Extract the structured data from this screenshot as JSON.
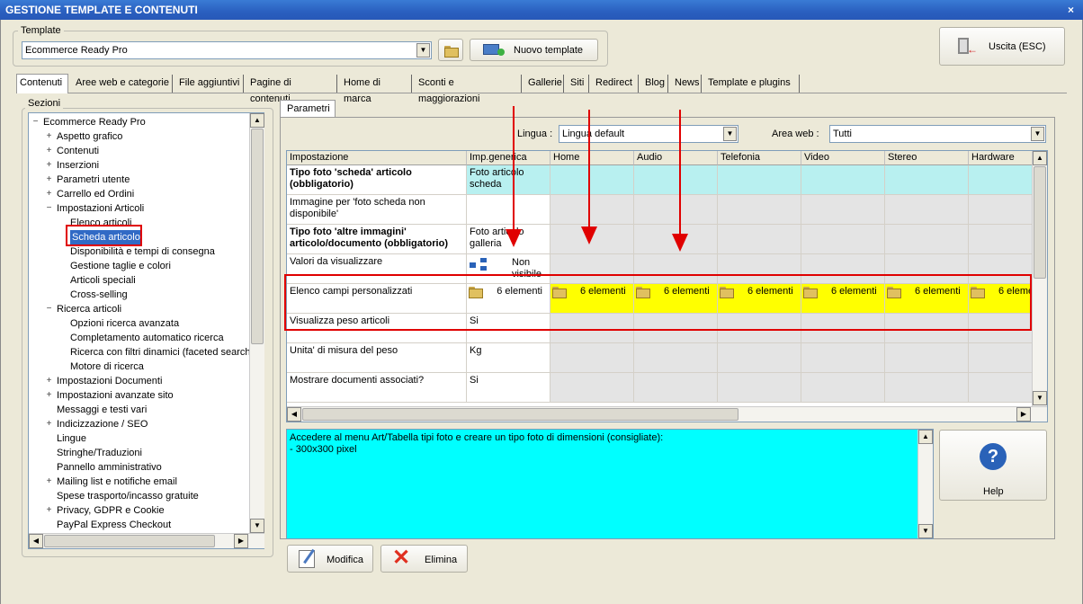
{
  "window": {
    "title": "GESTIONE TEMPLATE E CONTENUTI",
    "close": "×"
  },
  "template_group": {
    "label": "Template",
    "selected": "Ecommerce Ready Pro",
    "new_button": "Nuovo template"
  },
  "exit_button": "Uscita (ESC)",
  "tabs": [
    "Contenuti",
    "Aree web e categorie",
    "File aggiuntivi",
    "Pagine di contenuti",
    "Home di marca",
    "Sconti e maggiorazioni",
    "Gallerie",
    "Siti",
    "Redirect",
    "Blog",
    "News",
    "Template e plugins"
  ],
  "sections": {
    "label": "Sezioni",
    "tree": [
      {
        "label": "Ecommerce Ready Pro",
        "level": 0,
        "exp": "−"
      },
      {
        "label": "Aspetto grafico",
        "level": 1,
        "exp": "+"
      },
      {
        "label": "Contenuti",
        "level": 1,
        "exp": "+"
      },
      {
        "label": "Inserzioni",
        "level": 1,
        "exp": "+"
      },
      {
        "label": "Parametri utente",
        "level": 1,
        "exp": "+"
      },
      {
        "label": "Carrello ed Ordini",
        "level": 1,
        "exp": "+"
      },
      {
        "label": "Impostazioni Articoli",
        "level": 1,
        "exp": "−"
      },
      {
        "label": "Elenco articoli",
        "level": 2,
        "exp": ""
      },
      {
        "label": "Scheda articolo",
        "level": 2,
        "exp": "",
        "selected": true
      },
      {
        "label": "Disponibilità e tempi di consegna",
        "level": 2,
        "exp": ""
      },
      {
        "label": "Gestione taglie e colori",
        "level": 2,
        "exp": ""
      },
      {
        "label": "Articoli speciali",
        "level": 2,
        "exp": ""
      },
      {
        "label": "Cross-selling",
        "level": 2,
        "exp": ""
      },
      {
        "label": "Ricerca articoli",
        "level": 1,
        "exp": "−"
      },
      {
        "label": "Opzioni ricerca avanzata",
        "level": 2,
        "exp": ""
      },
      {
        "label": "Completamento automatico ricerca",
        "level": 2,
        "exp": ""
      },
      {
        "label": "Ricerca con filtri dinamici (faceted search)",
        "level": 2,
        "exp": ""
      },
      {
        "label": "Motore di ricerca",
        "level": 2,
        "exp": ""
      },
      {
        "label": "Impostazioni Documenti",
        "level": 1,
        "exp": "+"
      },
      {
        "label": "Impostazioni avanzate sito",
        "level": 1,
        "exp": "+"
      },
      {
        "label": "Messaggi e testi vari",
        "level": 1,
        "exp": ""
      },
      {
        "label": "Indicizzazione / SEO",
        "level": 1,
        "exp": "+"
      },
      {
        "label": "Lingue",
        "level": 1,
        "exp": ""
      },
      {
        "label": "Stringhe/Traduzioni",
        "level": 1,
        "exp": ""
      },
      {
        "label": "Pannello amministrativo",
        "level": 1,
        "exp": ""
      },
      {
        "label": "Mailing list e notifiche email",
        "level": 1,
        "exp": "+"
      },
      {
        "label": "Spese trasporto/incasso gratuite",
        "level": 1,
        "exp": ""
      },
      {
        "label": "Privacy, GDPR e Cookie",
        "level": 1,
        "exp": "+"
      },
      {
        "label": "PayPal Express Checkout",
        "level": 1,
        "exp": ""
      }
    ]
  },
  "params": {
    "tab": "Parametri",
    "lingua_label": "Lingua :",
    "lingua_value": "Lingua default",
    "area_label": "Area web :",
    "area_value": "Tutti",
    "columns": [
      "Impostazione",
      "Imp.generica",
      "Home",
      "Audio",
      "Telefonia",
      "Video",
      "Stereo",
      "Hardware"
    ],
    "rows": [
      {
        "name": "Tipo foto 'scheda' articolo (obbligatorio)",
        "value": "Foto articolo scheda",
        "bold": true
      },
      {
        "name": "Immagine per 'foto scheda non disponibile'",
        "value": "",
        "bold": false
      },
      {
        "name": "Tipo foto 'altre immagini' articolo/documento (obbligatorio)",
        "value": "Foto articolo galleria",
        "bold": true
      },
      {
        "name": "Valori da visualizzare",
        "value": "Non visibile",
        "bold": false
      },
      {
        "name": "Elenco campi personalizzati",
        "value": "6 elementi",
        "bold": false
      },
      {
        "name": "Visualizza peso articoli",
        "value": "Si",
        "bold": false
      },
      {
        "name": "",
        "value": "",
        "bold": false
      },
      {
        "name": "Unita' di misura del peso",
        "value": "Kg",
        "bold": false
      },
      {
        "name": "Mostrare documenti associati?",
        "value": "Si",
        "bold": false
      }
    ],
    "custom_fields_cells": [
      "6 elementi",
      "6 elementi",
      "6 elementi",
      "6 elementi",
      "6 elementi",
      "6 eleme"
    ]
  },
  "description": {
    "line1": "Accedere al menu Art/Tabella tipi foto e creare un tipo foto di dimensioni (consigliate):",
    "line2": "- 300x300 pixel"
  },
  "help_button": "Help",
  "modify_button": "Modifica",
  "delete_button": "Elimina",
  "colors": {
    "highlight_cyan": "#b8f0f0",
    "highlight_yellow": "#ffff00",
    "annotation_red": "#e00000",
    "desc_bg": "#00ffff"
  }
}
